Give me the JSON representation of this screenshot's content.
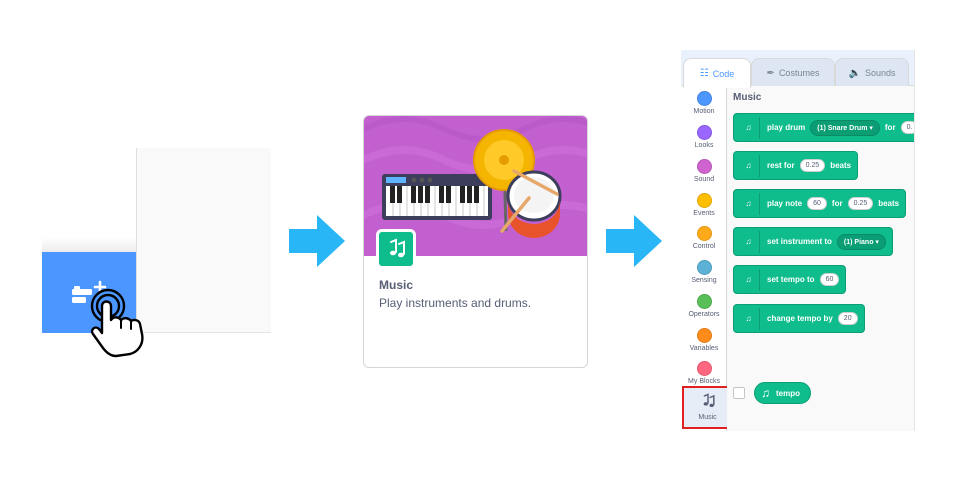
{
  "card": {
    "title": "Music",
    "description": "Play instruments and drums."
  },
  "editor": {
    "tabs": [
      {
        "label": "Code",
        "icon": "code-icon",
        "active": true
      },
      {
        "label": "Costumes",
        "icon": "brush-icon",
        "active": false
      },
      {
        "label": "Sounds",
        "icon": "speaker-icon",
        "active": false
      }
    ],
    "categories": [
      {
        "label": "Motion",
        "color": "#4c97ff"
      },
      {
        "label": "Looks",
        "color": "#9966ff"
      },
      {
        "label": "Sound",
        "color": "#cf63cf"
      },
      {
        "label": "Events",
        "color": "#ffbf00"
      },
      {
        "label": "Control",
        "color": "#ffab19"
      },
      {
        "label": "Sensing",
        "color": "#5cb1d6"
      },
      {
        "label": "Operators",
        "color": "#59c059"
      },
      {
        "label": "Variables",
        "color": "#ff8c1a"
      },
      {
        "label": "My Blocks",
        "color": "#ff6680"
      }
    ],
    "music_category": {
      "label": "Music",
      "highlighted": true
    },
    "palette_title": "Music",
    "blocks": {
      "play_drum": {
        "text": "play drum",
        "dropdown": "(1) Snare Drum",
        "for": "for",
        "value": "0."
      },
      "rest": {
        "text": "rest for",
        "value": "0.25",
        "unit": "beats"
      },
      "play_note": {
        "text": "play note",
        "note": "60",
        "for": "for",
        "value": "0.25",
        "unit": "beats"
      },
      "set_instrument": {
        "text": "set instrument to",
        "dropdown": "(1) Piano"
      },
      "set_tempo": {
        "text": "set tempo to",
        "value": "60"
      },
      "change_tempo": {
        "text": "change tempo by",
        "value": "20"
      },
      "tempo": {
        "text": "tempo"
      }
    }
  },
  "colors": {
    "accent_blue": "#4c97ff",
    "arrow_blue": "#29b6f6",
    "music_green": "#0fbd8c",
    "highlight_red": "#e02020",
    "card_purple": "#c260d0"
  }
}
